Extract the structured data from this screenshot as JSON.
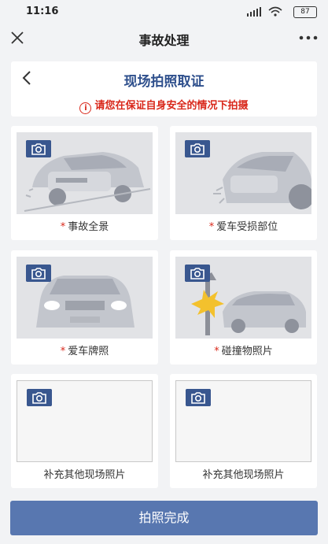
{
  "status": {
    "time": "11:16",
    "battery": "87"
  },
  "nav": {
    "title": "事故处理"
  },
  "header": {
    "title": "现场拍照取证",
    "warning": "请您在保证自身安全的情况下拍摄",
    "warning_icon": "i"
  },
  "tiles": [
    {
      "label": "事故全景",
      "required_mark": "*",
      "icon": "camera-icon"
    },
    {
      "label": "爱车受损部位",
      "required_mark": "*",
      "icon": "camera-icon"
    },
    {
      "label": "爱车牌照",
      "required_mark": "*",
      "icon": "camera-icon"
    },
    {
      "label": "碰撞物照片",
      "required_mark": "*",
      "icon": "camera-icon"
    },
    {
      "label": "补充其他现场照片",
      "required_mark": "",
      "icon": "camera-icon"
    },
    {
      "label": "补充其他现场照片",
      "required_mark": "",
      "icon": "camera-icon"
    }
  ],
  "footer": {
    "done_label": "拍照完成"
  },
  "colors": {
    "accent": "#2e4f8c",
    "button": "#5877b0",
    "warning": "#d9281b"
  }
}
